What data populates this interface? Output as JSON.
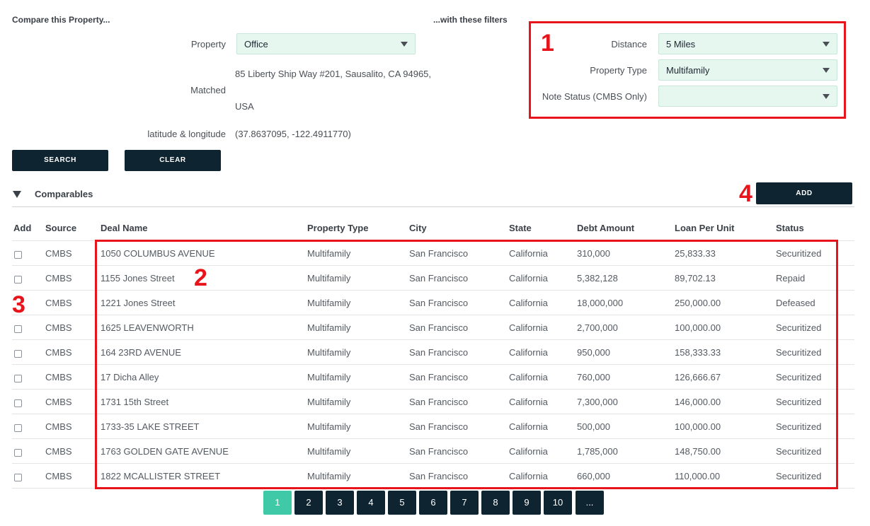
{
  "compare": {
    "heading": "Compare this Property...",
    "filters_heading": "...with these filters",
    "property_label": "Property",
    "property_value": "Office",
    "matched_label": "Matched",
    "matched_line1": "85 Liberty Ship Way #201, Sausalito, CA 94965,",
    "matched_line2": "USA",
    "latlng_label": "latitude & longitude",
    "latlng_value": "(37.8637095, -122.4911770)",
    "search_label": "SEARCH",
    "clear_label": "CLEAR"
  },
  "filters": {
    "distance_label": "Distance",
    "distance_value": "5 Miles",
    "property_type_label": "Property Type",
    "property_type_value": "Multifamily",
    "note_status_label": "Note Status (CMBS Only)",
    "note_status_value": ""
  },
  "comparables": {
    "section_label": "Comparables",
    "add_label": "ADD",
    "columns": [
      "Add",
      "Source",
      "Deal Name",
      "Property Type",
      "City",
      "State",
      "Debt Amount",
      "Loan Per Unit",
      "Status"
    ],
    "rows": [
      {
        "source": "CMBS",
        "deal": "1050 COLUMBUS AVENUE",
        "type": "Multifamily",
        "city": "San Francisco",
        "state": "California",
        "debt": "310,000",
        "per_unit": "25,833.33",
        "status": "Securitized",
        "checkbox": true
      },
      {
        "source": "CMBS",
        "deal": "1155 Jones Street",
        "type": "Multifamily",
        "city": "San Francisco",
        "state": "California",
        "debt": "5,382,128",
        "per_unit": "89,702.13",
        "status": "Repaid",
        "checkbox": true
      },
      {
        "source": "CMBS",
        "deal": "1221 Jones Street",
        "type": "Multifamily",
        "city": "San Francisco",
        "state": "California",
        "debt": "18,000,000",
        "per_unit": "250,000.00",
        "status": "Defeased",
        "checkbox": false
      },
      {
        "source": "CMBS",
        "deal": "1625 LEAVENWORTH",
        "type": "Multifamily",
        "city": "San Francisco",
        "state": "California",
        "debt": "2,700,000",
        "per_unit": "100,000.00",
        "status": "Securitized",
        "checkbox": true
      },
      {
        "source": "CMBS",
        "deal": "164 23RD AVENUE",
        "type": "Multifamily",
        "city": "San Francisco",
        "state": "California",
        "debt": "950,000",
        "per_unit": "158,333.33",
        "status": "Securitized",
        "checkbox": true
      },
      {
        "source": "CMBS",
        "deal": "17 Dicha Alley",
        "type": "Multifamily",
        "city": "San Francisco",
        "state": "California",
        "debt": "760,000",
        "per_unit": "126,666.67",
        "status": "Securitized",
        "checkbox": true
      },
      {
        "source": "CMBS",
        "deal": "1731 15th Street",
        "type": "Multifamily",
        "city": "San Francisco",
        "state": "California",
        "debt": "7,300,000",
        "per_unit": "146,000.00",
        "status": "Securitized",
        "checkbox": true
      },
      {
        "source": "CMBS",
        "deal": "1733-35 LAKE STREET",
        "type": "Multifamily",
        "city": "San Francisco",
        "state": "California",
        "debt": "500,000",
        "per_unit": "100,000.00",
        "status": "Securitized",
        "checkbox": true
      },
      {
        "source": "CMBS",
        "deal": "1763 GOLDEN GATE AVENUE",
        "type": "Multifamily",
        "city": "San Francisco",
        "state": "California",
        "debt": "1,785,000",
        "per_unit": "148,750.00",
        "status": "Securitized",
        "checkbox": true
      },
      {
        "source": "CMBS",
        "deal": "1822 MCALLISTER STREET",
        "type": "Multifamily",
        "city": "San Francisco",
        "state": "California",
        "debt": "660,000",
        "per_unit": "110,000.00",
        "status": "Securitized",
        "checkbox": true
      }
    ]
  },
  "pagination": {
    "pages": [
      "1",
      "2",
      "3",
      "4",
      "5",
      "6",
      "7",
      "8",
      "9",
      "10",
      "..."
    ],
    "active": "1"
  },
  "annotations": {
    "one": "1",
    "two": "2",
    "three": "3",
    "four": "4"
  },
  "colors": {
    "accent": "#40c9a6",
    "dark": "#0f2431",
    "annotation": "#e8141b",
    "select_bg": "#e6f7f0"
  }
}
